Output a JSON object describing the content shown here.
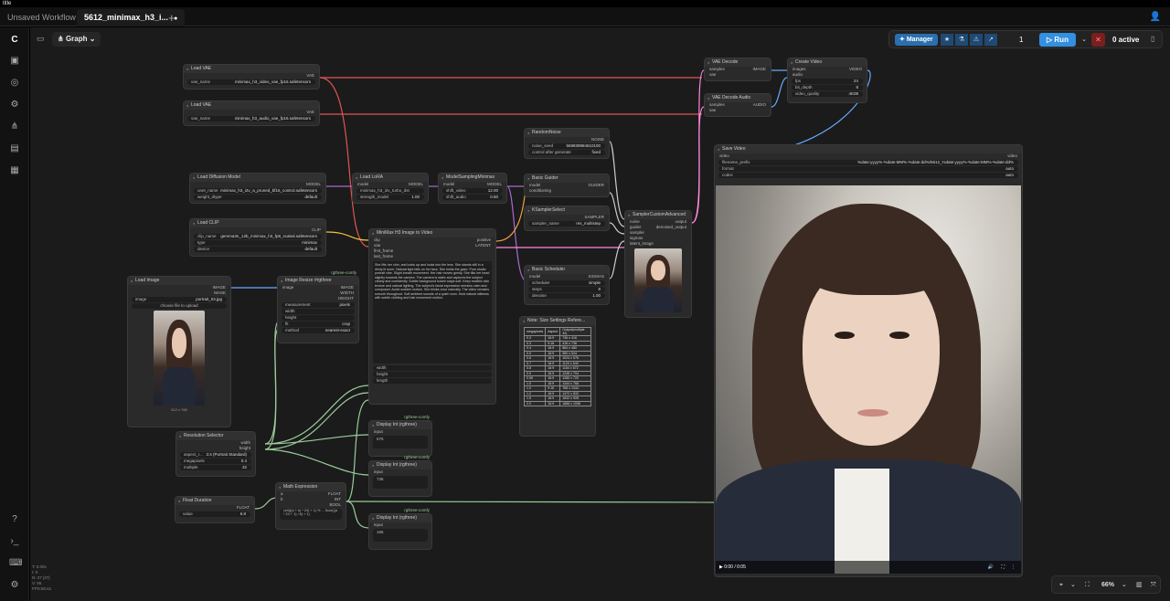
{
  "app": {
    "title": "title"
  },
  "tabs": [
    {
      "label": "Unsaved Workflow",
      "active": false
    },
    {
      "label": "5612_minimax_h3_i...",
      "active": true
    }
  ],
  "canvas_header": {
    "graph_label": "Graph"
  },
  "toolbar": {
    "manager_label": "Manager",
    "queue_count": "1",
    "run_label": "Run",
    "active_label": "0 active"
  },
  "bottom_bar": {
    "zoom": "66%"
  },
  "stats": [
    "T: 0.00s",
    "I: 0",
    "N: 37 [37]",
    "V: 56",
    "FPS:60.61"
  ],
  "nodes": {
    "load_vae_1": {
      "title": "Load VAE",
      "output": "VAE",
      "widget_label": "vae_name",
      "widget_value": "minimax_h3_video_vae_fp16.safetensors"
    },
    "load_vae_2": {
      "title": "Load VAE",
      "output": "VAE",
      "widget_label": "vae_name",
      "widget_value": "minimax_h3_audio_vae_fp16.safetensors"
    },
    "load_diffusion": {
      "title": "Load Diffusion Model",
      "output": "MODEL",
      "w1_label": "unet_name",
      "w1_value": "minimax_h3_i2v_a_pruned_bf16_control.safetensors",
      "w2_label": "weight_dtype",
      "w2_value": "default"
    },
    "load_clip": {
      "title": "Load CLIP",
      "output": "CLIP",
      "w1_label": "clip_name",
      "w1_value": "gemma3n_12b_minimax_h3_fp8_scaled.safetensors",
      "w2_label": "type",
      "w2_value": "minimax",
      "w3_label": "device",
      "w3_value": "default"
    },
    "load_lora": {
      "title": "Load LoRA",
      "output": "MODEL",
      "input": "model",
      "w1_label": "lora_name",
      "w1_value": "minimax_h3_i2v_turbo_dst",
      "w2_label": "strength_model",
      "w2_value": "1.00"
    },
    "model_sampling": {
      "title": "ModelSamplingMinimax",
      "output": "MODEL",
      "input": "model",
      "w1_label": "shift_video",
      "w1_value": "12.00",
      "w2_label": "shift_audio",
      "w2_value": "0.60"
    },
    "random_noise": {
      "title": "RandomNoise",
      "output": "NOISE",
      "w1_label": "noise_seed",
      "w1_value": "569839984610100",
      "w2_label": "control after generate",
      "w2_value": "fixed"
    },
    "basic_guider": {
      "title": "Basic Guider",
      "output": "GUIDER",
      "in1": "model",
      "in2": "conditioning"
    },
    "ksampler_select": {
      "title": "KSamplerSelect",
      "output": "SAMPLER",
      "w1_label": "sampler_name",
      "w1_value": "res_multistep"
    },
    "basic_scheduler": {
      "title": "Basic Scheduler",
      "output": "SIGMAS",
      "in1": "model",
      "w1_label": "scheduler",
      "w1_value": "simple",
      "w2_label": "steps",
      "w2_value": "8",
      "w3_label": "denoise",
      "w3_value": "1.00"
    },
    "sampler_custom": {
      "title": "SamplerCustomAdvanced",
      "out1": "output",
      "out2": "denoised_output",
      "in1": "noise",
      "in2": "guider",
      "in3": "sampler",
      "in4": "sigmas",
      "in5": "latent_image"
    },
    "vae_decode": {
      "title": "VAE Decode",
      "output": "IMAGE",
      "in1": "samples",
      "in2": "vae"
    },
    "vae_decode_audio": {
      "title": "VAE Decode Audio",
      "output": "AUDIO",
      "in1": "samples",
      "in2": "vae"
    },
    "create_video": {
      "title": "Create Video",
      "output": "VIDEO",
      "in1": "images",
      "in2": "audio",
      "w1_label": "fps",
      "w1_value": "24",
      "w2_label": "bit_depth",
      "w2_value": "8",
      "w3_label": "video_quality",
      "w3_value": "4K08"
    },
    "save_video": {
      "title": "Save Video",
      "in1": "video",
      "w1_label": "filename_prefix",
      "w1_value": "%date:yyyy%-%date:MM%-%date:dd%/5612_%date:yyyy%-%date:MM%-%date:dd%",
      "w2_label": "format",
      "w2_value": "auto",
      "w3_label": "codec",
      "w3_value": "auto",
      "time": "0:00 / 0:05"
    },
    "i2v": {
      "title": "MiniMax H3 Image to Video",
      "out1": "positive",
      "out2": "LATENT",
      "in1": "clip",
      "in2": "vae",
      "in3": "first_frame",
      "in4": "last_frame",
      "prompt": "She lifts her chin, and looks up and looks into the lens. She stands still in a dimly lit room. Natural light falls on her face. She holds the gaze. Pure studio portrait vibe. Slight breath movement. Her hair moves gently. She tilts her head slightly towards the camera. The camera is static and captures the subject clearly and confidently. Subtle background bokeh stays soft. Keep realistic skin texture and natural lighting. The subject's facial expression remains calm and composed. Avoid sudden motion. She blinks once naturally. The video remains smooth throughout. Soft ambient sounds of a quiet room. Hold natural stillness with subtle clothing and hair movement motion.",
      "w1": "width",
      "w2": "height",
      "w3": "length"
    },
    "load_image": {
      "title": "Load Image",
      "out1": "IMAGE",
      "out2": "MASK",
      "w1_label": "image",
      "w1_value": "portrait_03.jpg",
      "upload": "choose file to upload",
      "size": "512 x 768"
    },
    "image_resize": {
      "title": "Image Resize #rgthree",
      "badge": "rgthree-comfy",
      "out1": "IMAGE",
      "out2": "WIDTH",
      "out3": "HEIGHT",
      "in1": "image",
      "w1_label": "measurement",
      "w1_value": "pixels",
      "w2_label": "width",
      "w3_label": "height",
      "w4_label": "fit",
      "w4_value": "crop",
      "w5_label": "method",
      "w5_value": "nearest-exact"
    },
    "resolution_selector": {
      "title": "Resolution Selector",
      "out1": "width",
      "out2": "height",
      "w1_label": "aspect_r...",
      "w1_value": "3:4 (Portrait Standard)",
      "w2_label": "megapixels",
      "w2_value": "0.4",
      "w3_label": "multiple",
      "w3_value": "32"
    },
    "display_1": {
      "title": "Display Int (rgthree)",
      "badge": "rgthree-comfy",
      "input": "input",
      "value": "576"
    },
    "display_2": {
      "title": "Display Int (rgthree)",
      "badge": "rgthree-comfy",
      "input": "input",
      "value": "736"
    },
    "display_3": {
      "title": "Display Int (rgthree)",
      "badge": "rgthree-comfy",
      "input": "input",
      "value": "165"
    },
    "float_duration": {
      "title": "Float Duration",
      "output": "FLOAT",
      "w1_label": "value",
      "w1_value": "6.8"
    },
    "math_expr": {
      "title": "Math Expression",
      "in1": "a",
      "in2": "b",
      "out1": "FLOAT",
      "out2": "INT",
      "out3": "BOOL",
      "expr": "ceil(((a + b) * 24) + 1) % ... floor(((a * 24 + 1) / 8) + 1)"
    },
    "note_table": {
      "title": "Note: Size Settings Refere...",
      "headers": [
        "megapixels",
        "Aspect",
        "Output(multiple 32)"
      ],
      "rows": [
        [
          "0.3",
          "16:9",
          "736 x 416"
        ],
        [
          "0.3",
          "9:16",
          "416 x 736"
        ],
        [
          "0.4",
          "16:9",
          "864 x 480"
        ],
        [
          "0.5",
          "16:9",
          "960 x 544"
        ],
        [
          "0.6",
          "16:9",
          "1024 x 576"
        ],
        [
          "0.7",
          "16:9",
          "1120 x 640"
        ],
        [
          "0.8",
          "16:9",
          "1184 x 672"
        ],
        [
          "0.9",
          "16:9",
          "1248 x 704"
        ],
        [
          "0.96",
          "16:9",
          "1280 x 720"
        ],
        [
          "1.0",
          "16:9",
          "1344 x 768"
        ],
        [
          "1.0",
          "9:16",
          "768 x 1344"
        ],
        [
          "1.2",
          "16:9",
          "1472 x 832"
        ],
        [
          "1.5",
          "16:9",
          "1632 x 928"
        ],
        [
          "2.0",
          "16:9",
          "1888 x 1056"
        ]
      ]
    }
  }
}
